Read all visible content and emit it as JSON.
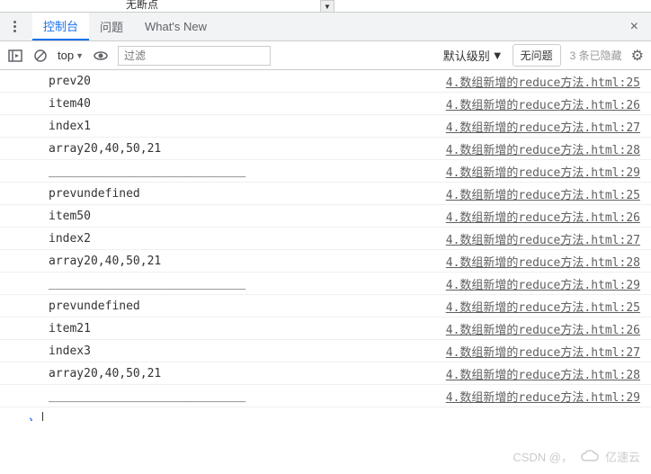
{
  "topbar": {
    "text": "无断点"
  },
  "header": {
    "tabs": [
      {
        "label": "控制台",
        "active": true
      },
      {
        "label": "问题",
        "active": false
      },
      {
        "label": "What's New",
        "active": false
      }
    ]
  },
  "toolbar": {
    "context": "top",
    "filter_placeholder": "过滤",
    "level": "默认级别",
    "no_issues": "无问题",
    "hidden": "3 条已隐藏"
  },
  "logs": [
    {
      "msg": "prev20",
      "src": "4.数组新增的reduce方法.html:25"
    },
    {
      "msg": "item40",
      "src": "4.数组新增的reduce方法.html:26"
    },
    {
      "msg": "index1",
      "src": "4.数组新增的reduce方法.html:27"
    },
    {
      "msg": "array20,40,50,21",
      "src": "4.数组新增的reduce方法.html:28"
    },
    {
      "msg": "____________________________",
      "src": "4.数组新增的reduce方法.html:29"
    },
    {
      "msg": "prevundefined",
      "src": "4.数组新增的reduce方法.html:25"
    },
    {
      "msg": "item50",
      "src": "4.数组新增的reduce方法.html:26"
    },
    {
      "msg": "index2",
      "src": "4.数组新增的reduce方法.html:27"
    },
    {
      "msg": "array20,40,50,21",
      "src": "4.数组新增的reduce方法.html:28"
    },
    {
      "msg": "____________________________",
      "src": "4.数组新增的reduce方法.html:29"
    },
    {
      "msg": "prevundefined",
      "src": "4.数组新增的reduce方法.html:25"
    },
    {
      "msg": "item21",
      "src": "4.数组新增的reduce方法.html:26"
    },
    {
      "msg": "index3",
      "src": "4.数组新增的reduce方法.html:27"
    },
    {
      "msg": "array20,40,50,21",
      "src": "4.数组新增的reduce方法.html:28"
    },
    {
      "msg": "____________________________",
      "src": "4.数组新增的reduce方法.html:29"
    }
  ],
  "watermark": {
    "csdn": "CSDN @，",
    "brand": "亿速云"
  }
}
